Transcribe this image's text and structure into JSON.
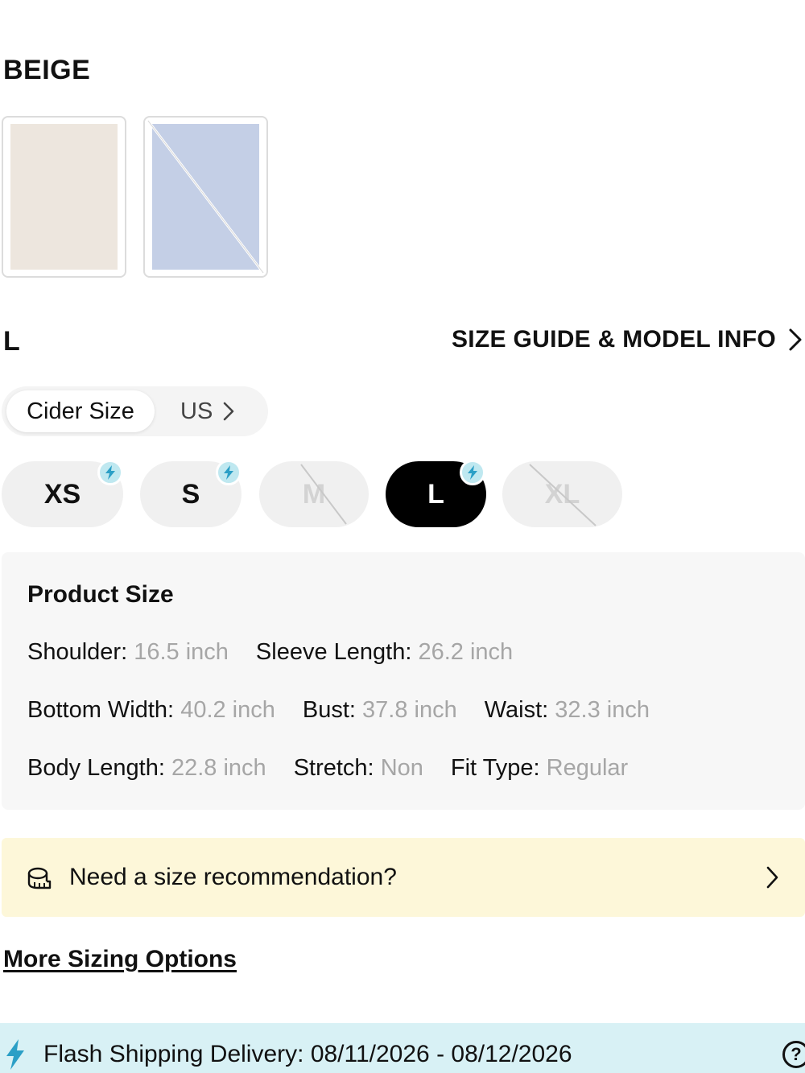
{
  "color": {
    "selected_name": "BEIGE",
    "swatches": [
      {
        "name": "beige",
        "hex": "#ede6de",
        "available": true,
        "selected": true
      },
      {
        "name": "light-blue",
        "hex": "#c4cfe6",
        "available": false,
        "selected": false
      }
    ]
  },
  "size": {
    "selected_label": "L",
    "guide_link": "SIZE GUIDE & MODEL INFO",
    "system_active": "Cider Size",
    "system_alt": "US",
    "options": [
      {
        "label": "XS",
        "available": true,
        "selected": false,
        "flash": true
      },
      {
        "label": "S",
        "available": true,
        "selected": false,
        "flash": true
      },
      {
        "label": "M",
        "available": false,
        "selected": false,
        "flash": false
      },
      {
        "label": "L",
        "available": true,
        "selected": true,
        "flash": true
      },
      {
        "label": "XL",
        "available": false,
        "selected": false,
        "flash": false
      }
    ]
  },
  "product_size": {
    "heading": "Product Size",
    "rows": [
      [
        {
          "key": "Shoulder:",
          "value": "16.5 inch"
        },
        {
          "key": "Sleeve Length:",
          "value": "26.2 inch"
        }
      ],
      [
        {
          "key": "Bottom Width:",
          "value": "40.2 inch"
        },
        {
          "key": "Bust:",
          "value": "37.8 inch"
        },
        {
          "key": "Waist:",
          "value": "32.3 inch"
        }
      ],
      [
        {
          "key": "Body Length:",
          "value": "22.8 inch"
        },
        {
          "key": "Stretch:",
          "value": "Non"
        },
        {
          "key": "Fit Type:",
          "value": "Regular"
        }
      ]
    ]
  },
  "recommendation": {
    "text": "Need a size recommendation?",
    "icon": "tape-measure-icon"
  },
  "more_sizing": "More Sizing Options",
  "flash_shipping": {
    "text": "Flash Shipping Delivery: 08/11/2026 - 08/12/2026",
    "help_glyph": "?",
    "accent": "#2b9fc6"
  }
}
